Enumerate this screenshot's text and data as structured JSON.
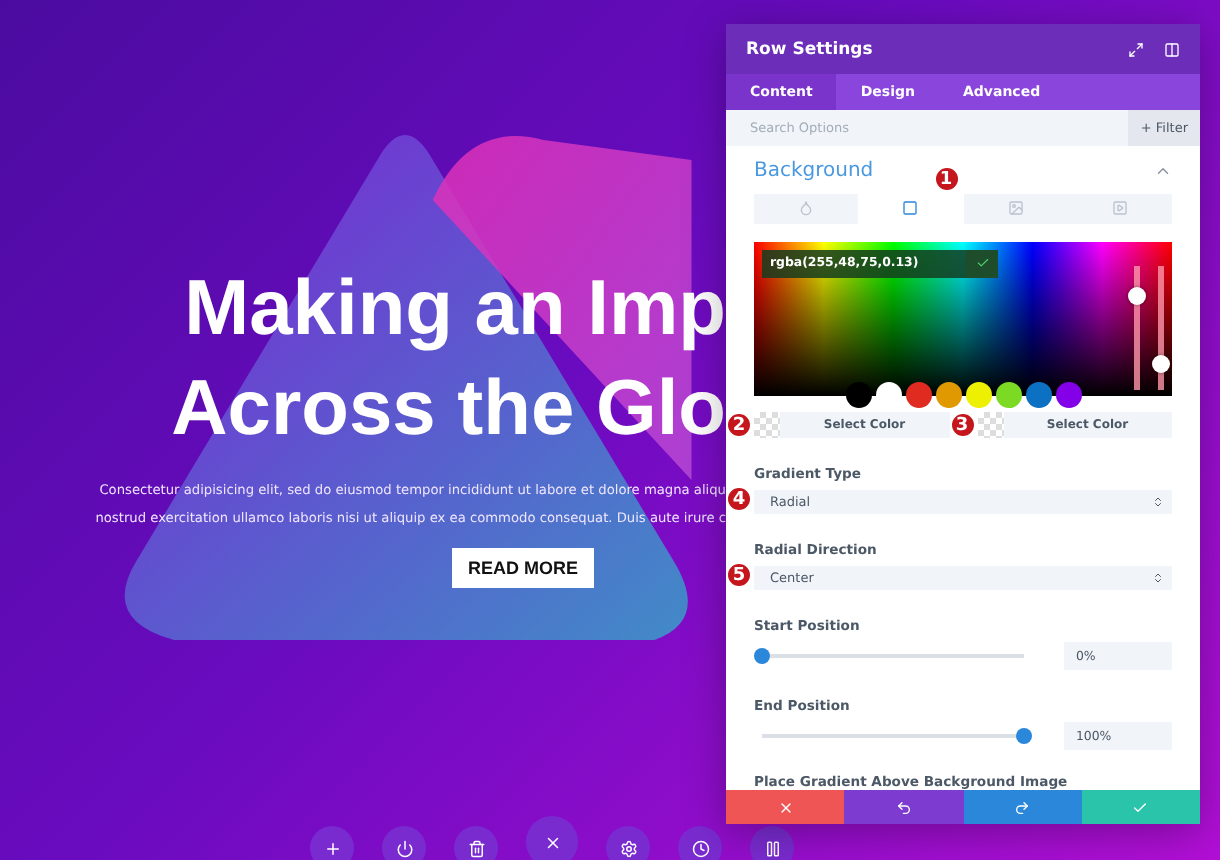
{
  "hero": {
    "heading_lines": [
      "Making an Imp",
      "Across the Glo"
    ],
    "paragraph_lines": [
      "Consectetur adipisicing elit, sed do eiusmod tempor incididunt ut labore et dolore magna aliqu",
      "nostrud exercitation ullamco laboris nisi ut aliquip ex ea commodo consequat. Duis aute irure c"
    ],
    "button": "READ MORE"
  },
  "builder_toolbar": [
    {
      "kind": "add"
    },
    {
      "kind": "power"
    },
    {
      "kind": "trash"
    },
    {
      "kind": "close"
    },
    {
      "kind": "settings"
    },
    {
      "kind": "history"
    },
    {
      "kind": "pause"
    }
  ],
  "panel": {
    "title": "Row Settings",
    "tabs": [
      {
        "label": "Content",
        "selected": true
      },
      {
        "label": "Design",
        "selected": false
      },
      {
        "label": "Advanced",
        "selected": false
      }
    ],
    "search": {
      "placeholder": "Search Options",
      "filter": "+ Filter"
    },
    "section": {
      "title": "Background",
      "expanded": true
    },
    "background_types": [
      {
        "kind": "color",
        "selected": false
      },
      {
        "kind": "gradient",
        "selected": true,
        "badge": "1"
      },
      {
        "kind": "image",
        "selected": false
      },
      {
        "kind": "video",
        "selected": false
      }
    ],
    "color_picker": {
      "value": "rgba(255,48,75,0.13)",
      "sliders": [
        {
          "level": 0.75
        },
        {
          "level": 0.2
        }
      ]
    },
    "swatches": [
      {
        "color": "#000000"
      },
      {
        "color": "#ffffff"
      },
      {
        "color": "#e02b20"
      },
      {
        "color": "#e09900"
      },
      {
        "color": "#edf000"
      },
      {
        "color": "#7cda24"
      },
      {
        "color": "#0c71c3"
      },
      {
        "color": "#8300e9"
      }
    ],
    "gradient_stops": [
      {
        "label": "Select Color",
        "badge": "2"
      },
      {
        "label": "Select Color",
        "badge": "3"
      }
    ],
    "fields": [
      {
        "kind": "select",
        "label": "Gradient Type",
        "value": "Radial",
        "badge": "4"
      },
      {
        "kind": "select",
        "label": "Radial Direction",
        "value": "Center",
        "badge": "5"
      },
      {
        "kind": "range",
        "label": "Start Position",
        "level": 0,
        "value": "0%"
      },
      {
        "kind": "range",
        "label": "End Position",
        "level": 1,
        "value": "100%"
      },
      {
        "kind": "heading",
        "label": "Place Gradient Above Background Image"
      }
    ],
    "footer": [
      {
        "kind": "cancel"
      },
      {
        "kind": "undo"
      },
      {
        "kind": "redo"
      },
      {
        "kind": "save"
      }
    ]
  }
}
